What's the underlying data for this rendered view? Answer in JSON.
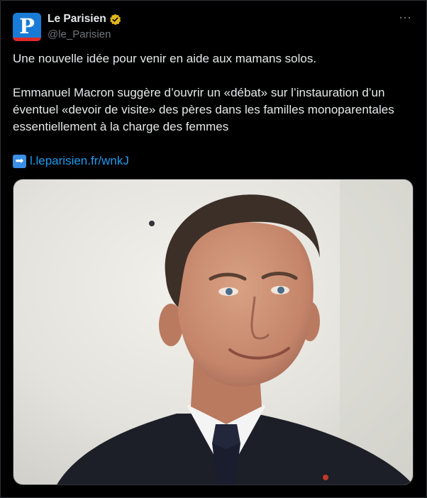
{
  "account": {
    "display_name": "Le Parisien",
    "handle": "@le_Parisien",
    "avatar_letter": "P",
    "verified": true
  },
  "tweet": {
    "line1": "Une nouvelle idée pour venir en aide aux mamans solos.",
    "paragraph2": "Emmanuel Macron suggère d’ouvrir un «débat» sur l’instauration d’un éventuel «devoir de visite» des pères dans les familles monoparentales essentiellement à la charge des femmes",
    "link_emoji": "➡",
    "link_text": "l.leparisien.fr/wnkJ"
  },
  "more_icon": "⋯",
  "colors": {
    "background": "#000000",
    "text": "#e7e9ea",
    "secondary": "#71767b",
    "link": "#1d9bf0",
    "avatar_blue": "#1a7bd6",
    "avatar_red": "#e02a2a",
    "verified_gold": "#e2b719"
  },
  "media": {
    "icon": "photo-icon"
  }
}
